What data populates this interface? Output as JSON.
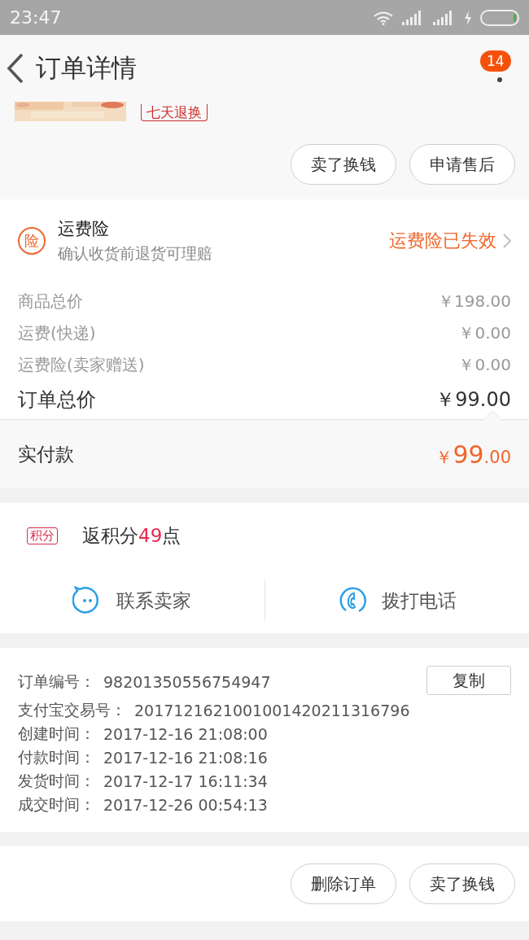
{
  "status_bar": {
    "time": "23:47"
  },
  "header": {
    "title": "订单详情",
    "badge": "14"
  },
  "product": {
    "kind": "picture",
    "tag": "七天退换"
  },
  "top_actions": [
    "卖了换钱",
    "申请售后"
  ],
  "insurance": {
    "icon": "险",
    "title": "运费险",
    "subtitle": "确认收货前退货可理赔",
    "status": "运费险已失效"
  },
  "price_lines": [
    {
      "label": "商品总价",
      "value": "￥198.00",
      "kind": "minor"
    },
    {
      "label": "运费(快递)",
      "value": "￥0.00",
      "kind": "minor"
    },
    {
      "label": "运费险(卖家赠送)",
      "value": "￥0.00",
      "kind": "minor"
    },
    {
      "label": "订单总价",
      "value": "￥99.00",
      "kind": "total"
    }
  ],
  "paid": {
    "label": "实付款",
    "symbol": "￥",
    "integer": "99",
    "decimal": ".00"
  },
  "points": {
    "badge": "积分",
    "prefix": "返积分",
    "amount": "49",
    "suffix": "点"
  },
  "contacts": [
    {
      "label": "联系卖家",
      "kind": "chat"
    },
    {
      "label": "拨打电话",
      "kind": "phone"
    }
  ],
  "order_info": {
    "copy_button": "复制",
    "rows": [
      {
        "label": "订单编号：",
        "value": "98201350556754947"
      },
      {
        "label": "支付宝交易号：",
        "value": "2017121621001001420211316796"
      },
      {
        "label": "创建时间：",
        "value": "2017-12-16 21:08:00"
      },
      {
        "label": "付款时间：",
        "value": "2017-12-16 21:08:16"
      },
      {
        "label": "发货时间：",
        "value": "2017-12-17 16:11:34"
      },
      {
        "label": "成交时间：",
        "value": "2017-12-26 00:54:13"
      }
    ]
  },
  "bottom_actions": [
    "删除订单",
    "卖了换钱"
  ]
}
